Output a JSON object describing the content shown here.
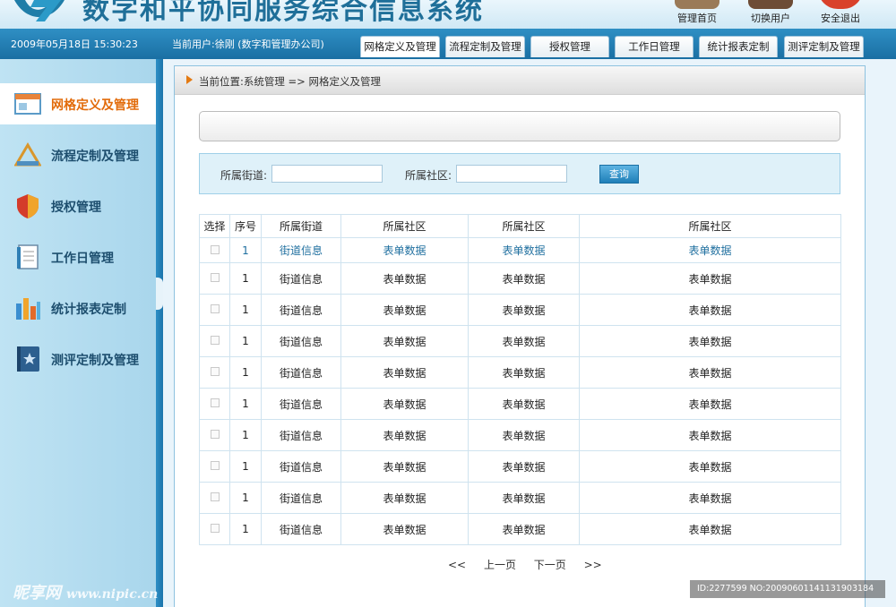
{
  "app": {
    "title": "数字和平协同服务综合信息系统",
    "top_buttons": [
      {
        "label": "管理首页",
        "icon": "home-icon",
        "color": "#8a6b4a"
      },
      {
        "label": "切换用户",
        "icon": "switch-user-icon",
        "color": "#6d4c36"
      },
      {
        "label": "安全退出",
        "icon": "logout-icon",
        "color": "#d9412b"
      }
    ]
  },
  "status": {
    "datetime": "2009年05月18日 15:30:23",
    "current_user": "当前用户:徐刚 (数字和管理办公司)"
  },
  "tabs": [
    {
      "label": "网格定义及管理",
      "active": true
    },
    {
      "label": "流程定制及管理",
      "active": false
    },
    {
      "label": "授权管理",
      "active": false
    },
    {
      "label": "工作日管理",
      "active": false
    },
    {
      "label": "统计报表定制",
      "active": false
    },
    {
      "label": "测评定制及管理",
      "active": false
    }
  ],
  "sidebar": {
    "items": [
      {
        "label": "网格定义及管理",
        "icon": "window-icon",
        "active": true
      },
      {
        "label": "流程定制及管理",
        "icon": "pencil-ruler-icon",
        "active": false
      },
      {
        "label": "授权管理",
        "icon": "shield-icon",
        "active": false
      },
      {
        "label": "工作日管理",
        "icon": "document-icon",
        "active": false
      },
      {
        "label": "统计报表定制",
        "icon": "bar-chart-icon",
        "active": false
      },
      {
        "label": "测评定制及管理",
        "icon": "star-book-icon",
        "active": false
      }
    ]
  },
  "breadcrumb": "当前位置:系统管理 => 网格定义及管理",
  "search": {
    "street_label": "所属街道:",
    "street_value": "",
    "community_label": "所属社区:",
    "community_value": "",
    "button_label": "查询"
  },
  "table": {
    "headers": [
      "选择",
      "序号",
      "所属街道",
      "所属社区",
      "所属社区",
      "所属社区"
    ],
    "rows": [
      [
        "",
        "1",
        "街道信息",
        "表单数据",
        "表单数据",
        "表单数据"
      ],
      [
        "",
        "1",
        "街道信息",
        "表单数据",
        "表单数据",
        "表单数据"
      ],
      [
        "",
        "1",
        "街道信息",
        "表单数据",
        "表单数据",
        "表单数据"
      ],
      [
        "",
        "1",
        "街道信息",
        "表单数据",
        "表单数据",
        "表单数据"
      ],
      [
        "",
        "1",
        "街道信息",
        "表单数据",
        "表单数据",
        "表单数据"
      ],
      [
        "",
        "1",
        "街道信息",
        "表单数据",
        "表单数据",
        "表单数据"
      ],
      [
        "",
        "1",
        "街道信息",
        "表单数据",
        "表单数据",
        "表单数据"
      ],
      [
        "",
        "1",
        "街道信息",
        "表单数据",
        "表单数据",
        "表单数据"
      ],
      [
        "",
        "1",
        "街道信息",
        "表单数据",
        "表单数据",
        "表单数据"
      ],
      [
        "",
        "1",
        "街道信息",
        "表单数据",
        "表单数据",
        "表单数据"
      ]
    ]
  },
  "pager": {
    "prev_symbol": "<<",
    "prev_label": "上一页",
    "next_label": "下一页",
    "next_symbol": ">>"
  },
  "watermark": {
    "left": "昵享网",
    "left_url": "www.nipic.cn",
    "right": "ID:2277599 NO:20090601141131903184"
  },
  "colors": {
    "brand_blue": "#1f6f99",
    "active_orange": "#e26b0a",
    "link_blue": "#1f6f9f"
  }
}
